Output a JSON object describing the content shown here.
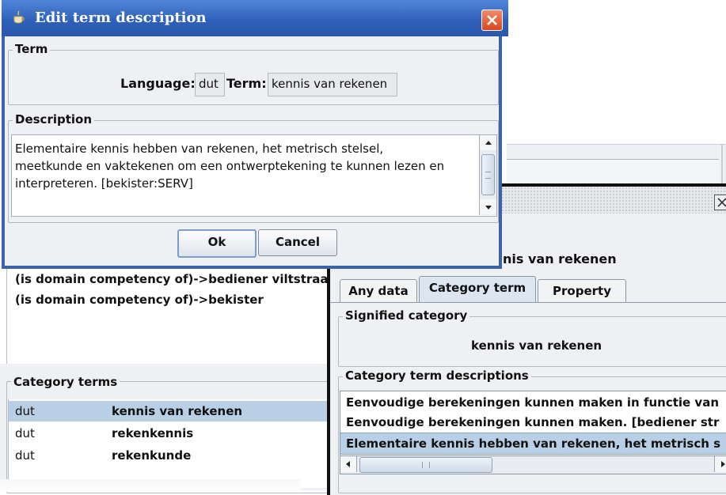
{
  "background_window": {
    "competency_items": [
      "(is domain competency of)->bediener viltstraa",
      "(is domain competency of)->bekister"
    ],
    "category_terms": {
      "legend": "Category terms",
      "rows": [
        {
          "lang": "dut",
          "term": "kennis van rekenen",
          "selected": true
        },
        {
          "lang": "dut",
          "term": "rekenkennis",
          "selected": false
        },
        {
          "lang": "dut",
          "term": "rekenkunde",
          "selected": false
        }
      ]
    }
  },
  "right_dialog": {
    "term_text": "nis van rekenen",
    "tabs": [
      {
        "label": "Any data",
        "active": false
      },
      {
        "label": "Category term",
        "active": true
      },
      {
        "label": "Property",
        "active": false
      }
    ],
    "signified_category": {
      "legend": "Signified category",
      "value": "kennis van rekenen"
    },
    "descriptions": {
      "legend": "Category term descriptions",
      "items": [
        "Eenvoudige berekeningen kunnen maken in functie van",
        "Eenvoudige berekeningen kunnen maken. [bediener str",
        "Elementaire kennis hebben van rekenen, het metrisch s"
      ],
      "selected_index": 2
    },
    "hscroll_grip": "|||"
  },
  "edit_dialog": {
    "title": "Edit term description",
    "term_section": {
      "legend": "Term",
      "language_label": "Language:",
      "language_value": "dut",
      "term_label": "Term:",
      "term_value": "kennis van rekenen"
    },
    "description_section": {
      "legend": "Description",
      "lines": [
        "Elementaire kennis hebben van rekenen, het metrisch stelsel,",
        "meetkunde en vaktekenen om een ontwerptekening te kunnen lezen en",
        "interpreteren. [bekister:SERV]"
      ]
    },
    "buttons": {
      "ok": "Ok",
      "cancel": "Cancel"
    },
    "colors": {
      "titlebar": "#2e5fb7",
      "close_button": "#d9461f",
      "selection": "#b8cfe5"
    }
  }
}
